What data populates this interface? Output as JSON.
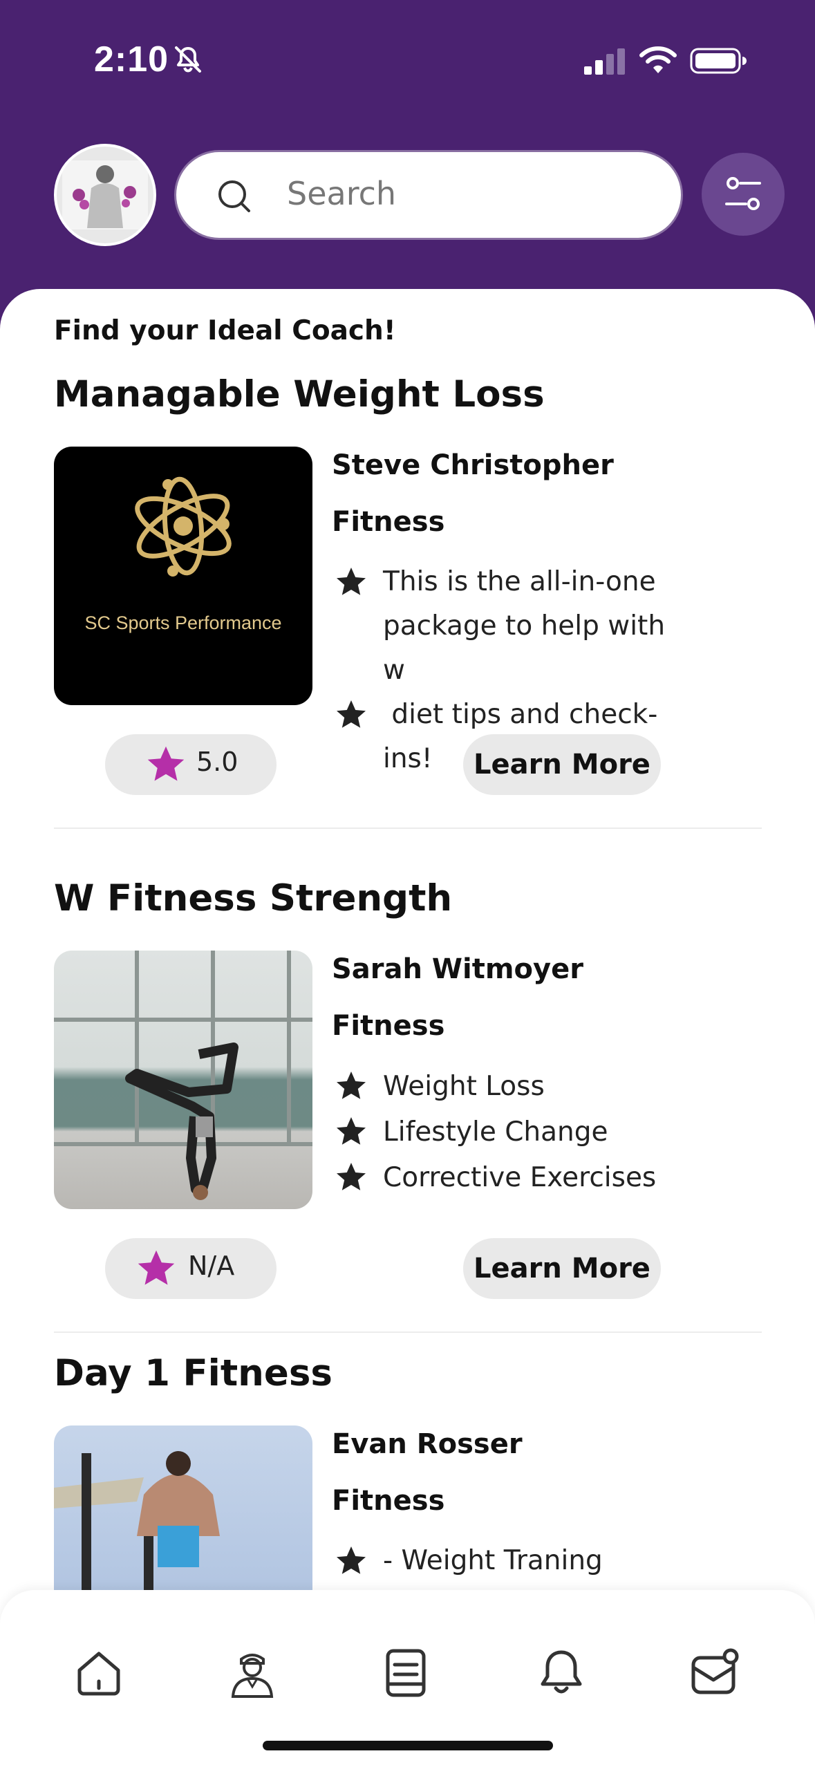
{
  "status_bar": {
    "time": "2:10",
    "icons": [
      "bell-slash-icon",
      "cellular-signal-icon",
      "wifi-icon",
      "battery-icon"
    ]
  },
  "header": {
    "search_placeholder": "Search",
    "icons": [
      "avatar",
      "search-icon",
      "filter-icon"
    ]
  },
  "content": {
    "tagline": "Find your Ideal Coach!",
    "learn_more_label": "Learn More",
    "coaches": [
      {
        "title": "Managable Weight Loss",
        "coach_name": "Steve Christopher",
        "category": "Fitness",
        "image_text": "SC Sports Performance",
        "features": [
          "This is the all-in-one package to help with w",
          " diet tips and check-ins!"
        ],
        "rating": "5.0"
      },
      {
        "title": "W Fitness Strength",
        "coach_name": "Sarah Witmoyer",
        "category": "Fitness",
        "features": [
          "Weight Loss",
          "Lifestyle Change",
          "Corrective Exercises"
        ],
        "rating": "N/A"
      },
      {
        "title": "Day 1 Fitness",
        "coach_name": "Evan Rosser",
        "category": "Fitness",
        "features": [
          "- Weight Traning"
        ]
      }
    ]
  },
  "colors": {
    "header_purple": "#4a2270",
    "filter_button": "#6a4790",
    "rating_star": "#b52fa8",
    "chip_background": "#e9e9e9"
  },
  "bottom_nav": {
    "icons": [
      "home-icon",
      "coach-icon",
      "programs-icon",
      "bell-icon",
      "inbox-icon"
    ]
  }
}
